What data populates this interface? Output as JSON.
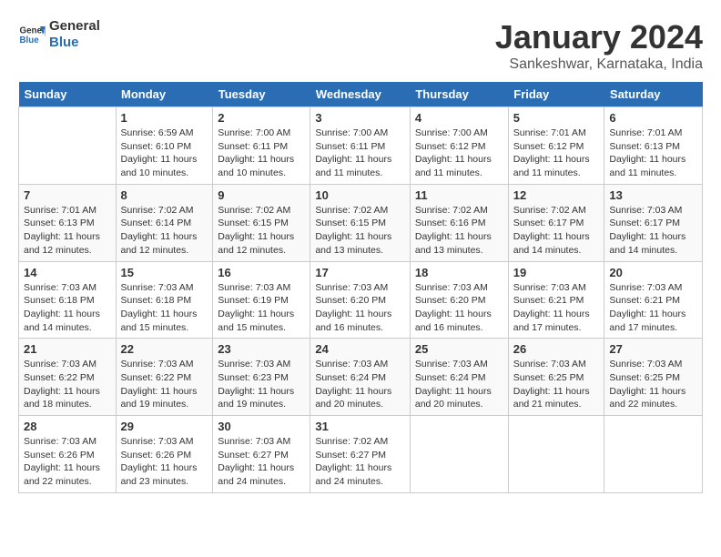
{
  "logo": {
    "text_general": "General",
    "text_blue": "Blue"
  },
  "title": "January 2024",
  "subtitle": "Sankeshwar, Karnataka, India",
  "days_of_week": [
    "Sunday",
    "Monday",
    "Tuesday",
    "Wednesday",
    "Thursday",
    "Friday",
    "Saturday"
  ],
  "weeks": [
    [
      {
        "day": "",
        "info": ""
      },
      {
        "day": "1",
        "info": "Sunrise: 6:59 AM\nSunset: 6:10 PM\nDaylight: 11 hours\nand 10 minutes."
      },
      {
        "day": "2",
        "info": "Sunrise: 7:00 AM\nSunset: 6:11 PM\nDaylight: 11 hours\nand 10 minutes."
      },
      {
        "day": "3",
        "info": "Sunrise: 7:00 AM\nSunset: 6:11 PM\nDaylight: 11 hours\nand 11 minutes."
      },
      {
        "day": "4",
        "info": "Sunrise: 7:00 AM\nSunset: 6:12 PM\nDaylight: 11 hours\nand 11 minutes."
      },
      {
        "day": "5",
        "info": "Sunrise: 7:01 AM\nSunset: 6:12 PM\nDaylight: 11 hours\nand 11 minutes."
      },
      {
        "day": "6",
        "info": "Sunrise: 7:01 AM\nSunset: 6:13 PM\nDaylight: 11 hours\nand 11 minutes."
      }
    ],
    [
      {
        "day": "7",
        "info": "Sunrise: 7:01 AM\nSunset: 6:13 PM\nDaylight: 11 hours\nand 12 minutes."
      },
      {
        "day": "8",
        "info": "Sunrise: 7:02 AM\nSunset: 6:14 PM\nDaylight: 11 hours\nand 12 minutes."
      },
      {
        "day": "9",
        "info": "Sunrise: 7:02 AM\nSunset: 6:15 PM\nDaylight: 11 hours\nand 12 minutes."
      },
      {
        "day": "10",
        "info": "Sunrise: 7:02 AM\nSunset: 6:15 PM\nDaylight: 11 hours\nand 13 minutes."
      },
      {
        "day": "11",
        "info": "Sunrise: 7:02 AM\nSunset: 6:16 PM\nDaylight: 11 hours\nand 13 minutes."
      },
      {
        "day": "12",
        "info": "Sunrise: 7:02 AM\nSunset: 6:17 PM\nDaylight: 11 hours\nand 14 minutes."
      },
      {
        "day": "13",
        "info": "Sunrise: 7:03 AM\nSunset: 6:17 PM\nDaylight: 11 hours\nand 14 minutes."
      }
    ],
    [
      {
        "day": "14",
        "info": "Sunrise: 7:03 AM\nSunset: 6:18 PM\nDaylight: 11 hours\nand 14 minutes."
      },
      {
        "day": "15",
        "info": "Sunrise: 7:03 AM\nSunset: 6:18 PM\nDaylight: 11 hours\nand 15 minutes."
      },
      {
        "day": "16",
        "info": "Sunrise: 7:03 AM\nSunset: 6:19 PM\nDaylight: 11 hours\nand 15 minutes."
      },
      {
        "day": "17",
        "info": "Sunrise: 7:03 AM\nSunset: 6:20 PM\nDaylight: 11 hours\nand 16 minutes."
      },
      {
        "day": "18",
        "info": "Sunrise: 7:03 AM\nSunset: 6:20 PM\nDaylight: 11 hours\nand 16 minutes."
      },
      {
        "day": "19",
        "info": "Sunrise: 7:03 AM\nSunset: 6:21 PM\nDaylight: 11 hours\nand 17 minutes."
      },
      {
        "day": "20",
        "info": "Sunrise: 7:03 AM\nSunset: 6:21 PM\nDaylight: 11 hours\nand 17 minutes."
      }
    ],
    [
      {
        "day": "21",
        "info": "Sunrise: 7:03 AM\nSunset: 6:22 PM\nDaylight: 11 hours\nand 18 minutes."
      },
      {
        "day": "22",
        "info": "Sunrise: 7:03 AM\nSunset: 6:22 PM\nDaylight: 11 hours\nand 19 minutes."
      },
      {
        "day": "23",
        "info": "Sunrise: 7:03 AM\nSunset: 6:23 PM\nDaylight: 11 hours\nand 19 minutes."
      },
      {
        "day": "24",
        "info": "Sunrise: 7:03 AM\nSunset: 6:24 PM\nDaylight: 11 hours\nand 20 minutes."
      },
      {
        "day": "25",
        "info": "Sunrise: 7:03 AM\nSunset: 6:24 PM\nDaylight: 11 hours\nand 20 minutes."
      },
      {
        "day": "26",
        "info": "Sunrise: 7:03 AM\nSunset: 6:25 PM\nDaylight: 11 hours\nand 21 minutes."
      },
      {
        "day": "27",
        "info": "Sunrise: 7:03 AM\nSunset: 6:25 PM\nDaylight: 11 hours\nand 22 minutes."
      }
    ],
    [
      {
        "day": "28",
        "info": "Sunrise: 7:03 AM\nSunset: 6:26 PM\nDaylight: 11 hours\nand 22 minutes."
      },
      {
        "day": "29",
        "info": "Sunrise: 7:03 AM\nSunset: 6:26 PM\nDaylight: 11 hours\nand 23 minutes."
      },
      {
        "day": "30",
        "info": "Sunrise: 7:03 AM\nSunset: 6:27 PM\nDaylight: 11 hours\nand 24 minutes."
      },
      {
        "day": "31",
        "info": "Sunrise: 7:02 AM\nSunset: 6:27 PM\nDaylight: 11 hours\nand 24 minutes."
      },
      {
        "day": "",
        "info": ""
      },
      {
        "day": "",
        "info": ""
      },
      {
        "day": "",
        "info": ""
      }
    ]
  ]
}
